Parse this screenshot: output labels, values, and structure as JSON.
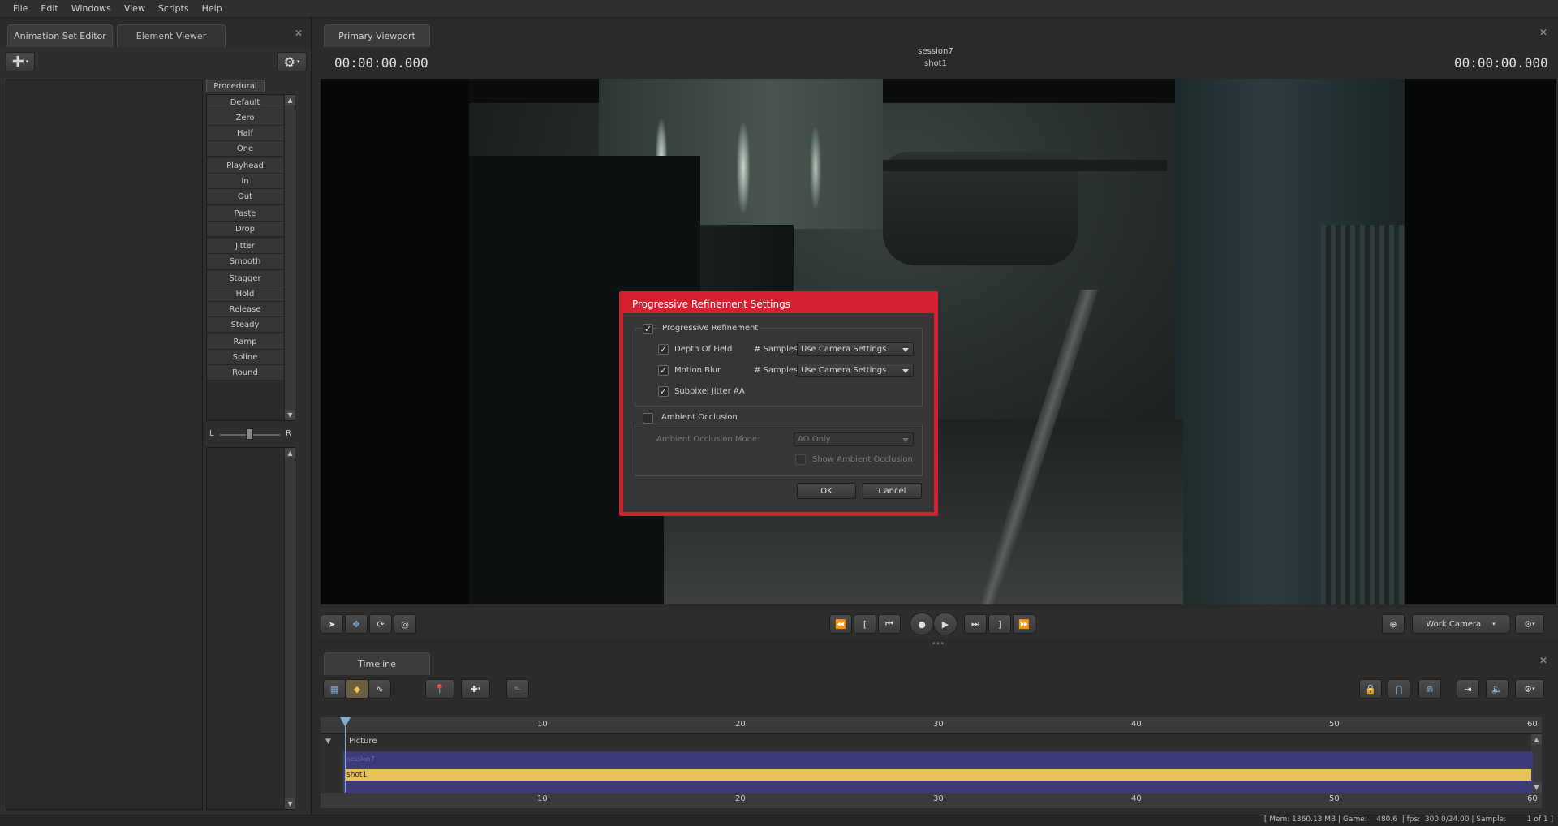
{
  "menu": [
    "File",
    "Edit",
    "Windows",
    "View",
    "Scripts",
    "Help"
  ],
  "left_panel": {
    "tabs": [
      "Animation Set Editor",
      "Element Viewer"
    ],
    "procedural_tab": "Procedural",
    "procedural_items": [
      "Default",
      "Zero",
      "Half",
      "One",
      "Playhead",
      "In",
      "Out",
      "Paste",
      "Drop",
      "Jitter",
      "Smooth",
      "Stagger",
      "Hold",
      "Release",
      "Steady",
      "Ramp",
      "Spline",
      "Round"
    ],
    "balance_left": "L",
    "balance_right": "R"
  },
  "viewport": {
    "tab": "Primary Viewport",
    "session": "session7",
    "shot": "shot1",
    "timecode_left": "00:00:00.000",
    "timecode_right": "00:00:00.000",
    "camera": "Work Camera"
  },
  "dialog": {
    "title": "Progressive Refinement Settings",
    "progressive_refinement": {
      "label": "Progressive Refinement",
      "checked": true
    },
    "depth_of_field": {
      "label": "Depth Of Field",
      "checked": true,
      "samples_label": "# Samples",
      "samples_value": "Use Camera Settings"
    },
    "motion_blur": {
      "label": "Motion Blur",
      "checked": true,
      "samples_label": "# Samples",
      "samples_value": "Use Camera Settings"
    },
    "subpixel_jitter": {
      "label": "Subpixel Jitter AA",
      "checked": true
    },
    "ambient_occlusion": {
      "label": "Ambient Occlusion",
      "checked": false
    },
    "ao_mode_label": "Ambient Occlusion Mode:",
    "ao_mode_value": "AO Only",
    "show_ao": {
      "label": "Show Ambient Occlusion",
      "checked": false
    },
    "ok": "OK",
    "cancel": "Cancel"
  },
  "timeline": {
    "tab": "Timeline",
    "ticks": [
      "10",
      "20",
      "30",
      "40",
      "50",
      "60"
    ],
    "track_label": "Picture",
    "filmclip_label": "session7",
    "shot_label": "shot1"
  },
  "status": {
    "text": "[ Mem: 1360.13 MB | Game:    480.6  | fps:  300.0/24.00 | Sample:         1 of 1 ]"
  },
  "colors": {
    "dialog_border": "#d4202f",
    "shot_bar": "#e7c25a",
    "film_track": "#3c3a7a",
    "playhead": "#7fb0d8"
  }
}
